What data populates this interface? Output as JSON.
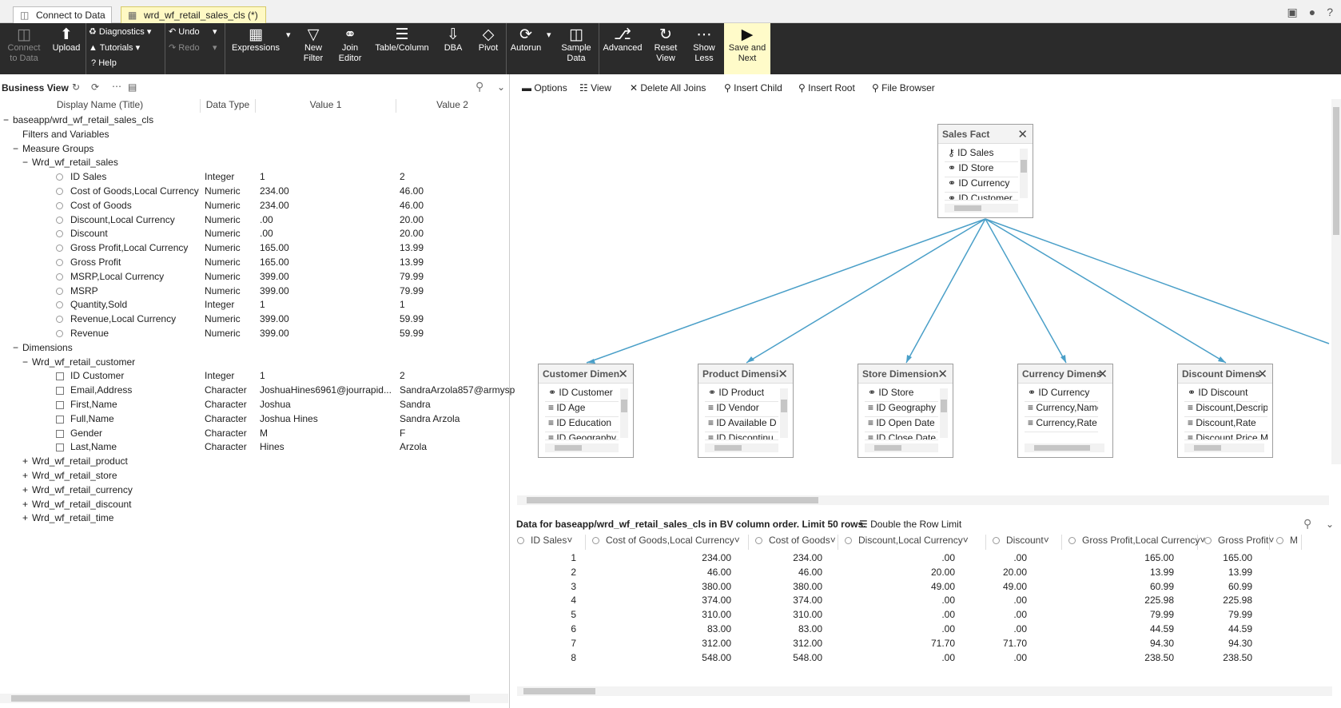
{
  "tabs": [
    {
      "label": "Connect to Data",
      "icon": "database-icon"
    },
    {
      "label": "wrd_wf_retail_sales_cls (*)",
      "icon": "schema-icon"
    }
  ],
  "toolbar": {
    "connect": "Connect\nto Data",
    "upload": "Upload",
    "diagnostics": "Diagnostics",
    "tutorials": "Tutorials",
    "help": "Help",
    "undo": "Undo",
    "redo": "Redo",
    "expressions": "Expressions",
    "new_filter": "New\nFilter",
    "join_editor": "Join\nEditor",
    "table_column": "Table/Column",
    "dba": "DBA",
    "pivot": "Pivot",
    "autorun": "Autorun",
    "sample_data": "Sample\nData",
    "advanced": "Advanced",
    "reset_view": "Reset\nView",
    "show_less": "Show\nLess",
    "save_next": "Save and\nNext"
  },
  "business_view": {
    "title": "Business View",
    "columns": [
      "Display Name (Title)",
      "Data Type",
      "Value 1",
      "Value 2"
    ],
    "rows": [
      {
        "indent": 0,
        "toggle": "−",
        "icon": "",
        "name": "baseapp/wrd_wf_retail_sales_cls",
        "type": "",
        "v1": "",
        "v2": ""
      },
      {
        "indent": 1,
        "toggle": "",
        "icon": "",
        "name": "Filters and Variables",
        "type": "",
        "v1": "",
        "v2": ""
      },
      {
        "indent": 1,
        "toggle": "−",
        "icon": "",
        "name": "Measure Groups",
        "type": "",
        "v1": "",
        "v2": ""
      },
      {
        "indent": 2,
        "toggle": "−",
        "icon": "",
        "name": "Wrd_wf_retail_sales",
        "type": "",
        "v1": "",
        "v2": ""
      },
      {
        "indent": 3,
        "toggle": "",
        "icon": "circ",
        "name": "ID Sales",
        "type": "Integer",
        "v1": "1",
        "v2": "2"
      },
      {
        "indent": 3,
        "toggle": "",
        "icon": "circ",
        "name": "Cost of Goods,Local Currency",
        "type": "Numeric",
        "v1": "234.00",
        "v2": "46.00"
      },
      {
        "indent": 3,
        "toggle": "",
        "icon": "circ",
        "name": "Cost of Goods",
        "type": "Numeric",
        "v1": "234.00",
        "v2": "46.00"
      },
      {
        "indent": 3,
        "toggle": "",
        "icon": "circ",
        "name": "Discount,Local Currency",
        "type": "Numeric",
        "v1": ".00",
        "v2": "20.00"
      },
      {
        "indent": 3,
        "toggle": "",
        "icon": "circ",
        "name": "Discount",
        "type": "Numeric",
        "v1": ".00",
        "v2": "20.00"
      },
      {
        "indent": 3,
        "toggle": "",
        "icon": "circ",
        "name": "Gross Profit,Local Currency",
        "type": "Numeric",
        "v1": "165.00",
        "v2": "13.99"
      },
      {
        "indent": 3,
        "toggle": "",
        "icon": "circ",
        "name": "Gross Profit",
        "type": "Numeric",
        "v1": "165.00",
        "v2": "13.99"
      },
      {
        "indent": 3,
        "toggle": "",
        "icon": "circ",
        "name": "MSRP,Local Currency",
        "type": "Numeric",
        "v1": "399.00",
        "v2": "79.99"
      },
      {
        "indent": 3,
        "toggle": "",
        "icon": "circ",
        "name": "MSRP",
        "type": "Numeric",
        "v1": "399.00",
        "v2": "79.99"
      },
      {
        "indent": 3,
        "toggle": "",
        "icon": "circ",
        "name": "Quantity,Sold",
        "type": "Integer",
        "v1": "1",
        "v2": "1"
      },
      {
        "indent": 3,
        "toggle": "",
        "icon": "circ",
        "name": "Revenue,Local Currency",
        "type": "Numeric",
        "v1": "399.00",
        "v2": "59.99"
      },
      {
        "indent": 3,
        "toggle": "",
        "icon": "circ",
        "name": "Revenue",
        "type": "Numeric",
        "v1": "399.00",
        "v2": "59.99"
      },
      {
        "indent": 1,
        "toggle": "−",
        "icon": "",
        "name": "Dimensions",
        "type": "",
        "v1": "",
        "v2": ""
      },
      {
        "indent": 2,
        "toggle": "−",
        "icon": "",
        "name": "Wrd_wf_retail_customer",
        "type": "",
        "v1": "",
        "v2": ""
      },
      {
        "indent": 3,
        "toggle": "",
        "icon": "sq",
        "name": "ID Customer",
        "type": "Integer",
        "v1": "1",
        "v2": "2"
      },
      {
        "indent": 3,
        "toggle": "",
        "icon": "sq",
        "name": "Email,Address",
        "type": "Character",
        "v1": "JoshuaHines6961@jourrapid...",
        "v2": "SandraArzola857@armysp"
      },
      {
        "indent": 3,
        "toggle": "",
        "icon": "sq",
        "name": "First,Name",
        "type": "Character",
        "v1": "Joshua",
        "v2": "Sandra"
      },
      {
        "indent": 3,
        "toggle": "",
        "icon": "sq",
        "name": "Full,Name",
        "type": "Character",
        "v1": "Joshua Hines",
        "v2": "Sandra Arzola"
      },
      {
        "indent": 3,
        "toggle": "",
        "icon": "sq",
        "name": "Gender",
        "type": "Character",
        "v1": "M",
        "v2": "F"
      },
      {
        "indent": 3,
        "toggle": "",
        "icon": "sq",
        "name": "Last,Name",
        "type": "Character",
        "v1": "Hines",
        "v2": "Arzola"
      },
      {
        "indent": 2,
        "toggle": "+",
        "icon": "",
        "name": "Wrd_wf_retail_product",
        "type": "",
        "v1": "",
        "v2": ""
      },
      {
        "indent": 2,
        "toggle": "+",
        "icon": "",
        "name": "Wrd_wf_retail_store",
        "type": "",
        "v1": "",
        "v2": ""
      },
      {
        "indent": 2,
        "toggle": "+",
        "icon": "",
        "name": "Wrd_wf_retail_currency",
        "type": "",
        "v1": "",
        "v2": ""
      },
      {
        "indent": 2,
        "toggle": "+",
        "icon": "",
        "name": "Wrd_wf_retail_discount",
        "type": "",
        "v1": "",
        "v2": ""
      },
      {
        "indent": 2,
        "toggle": "+",
        "icon": "",
        "name": "Wrd_wf_retail_time",
        "type": "",
        "v1": "",
        "v2": ""
      }
    ]
  },
  "join_toolbar": {
    "options": "Options",
    "view": "View",
    "delete_joins": "Delete All Joins",
    "insert_child": "Insert Child",
    "insert_root": "Insert Root",
    "file_browser": "File Browser"
  },
  "join_tables": {
    "fact": {
      "title": "Sales Fact",
      "fields": [
        "ID Sales",
        "ID Store",
        "ID Currency",
        "ID Customer"
      ]
    },
    "dims": [
      {
        "title": "Customer Dimen",
        "fields": [
          "ID Customer",
          "ID Age",
          "ID Education",
          "ID Geography"
        ]
      },
      {
        "title": "Product Dimensi",
        "fields": [
          "ID Product",
          "ID Vendor",
          "ID Available D",
          "ID Discontinu"
        ]
      },
      {
        "title": "Store Dimension",
        "fields": [
          "ID Store",
          "ID Geography",
          "ID Open Date",
          "ID Close Date"
        ]
      },
      {
        "title": "Currency Dimens",
        "fields": [
          "ID Currency",
          "Currency,Name",
          "Currency,Rate"
        ]
      },
      {
        "title": "Discount Dimens",
        "fields": [
          "ID Discount",
          "Discount,Descrip",
          "Discount,Rate",
          "Discount,Price M"
        ]
      }
    ]
  },
  "data_grid": {
    "caption": "Data for baseapp/wrd_wf_retail_sales_cls in BV column order. Limit 50 rows.",
    "double_limit": "Double the Row Limit",
    "columns": [
      "ID Sales",
      "Cost of Goods,Local Currency",
      "Cost of Goods",
      "Discount,Local Currency",
      "Discount",
      "Gross Profit,Local Currency",
      "Gross Profit",
      "M"
    ],
    "rows": [
      [
        "1",
        "234.00",
        "234.00",
        ".00",
        ".00",
        "165.00",
        "165.00"
      ],
      [
        "2",
        "46.00",
        "46.00",
        "20.00",
        "20.00",
        "13.99",
        "13.99"
      ],
      [
        "3",
        "380.00",
        "380.00",
        "49.00",
        "49.00",
        "60.99",
        "60.99"
      ],
      [
        "4",
        "374.00",
        "374.00",
        ".00",
        ".00",
        "225.98",
        "225.98"
      ],
      [
        "5",
        "310.00",
        "310.00",
        ".00",
        ".00",
        "79.99",
        "79.99"
      ],
      [
        "6",
        "83.00",
        "83.00",
        ".00",
        ".00",
        "44.59",
        "44.59"
      ],
      [
        "7",
        "312.00",
        "312.00",
        "71.70",
        "71.70",
        "94.30",
        "94.30"
      ],
      [
        "8",
        "548.00",
        "548.00",
        ".00",
        ".00",
        "238.50",
        "238.50"
      ]
    ]
  },
  "colors": {
    "toolbar_bg": "#2b2b2b",
    "active_tab": "#fff9c4",
    "join_line": "#4a9fc8",
    "save_next_bg": "#fffbc9"
  }
}
